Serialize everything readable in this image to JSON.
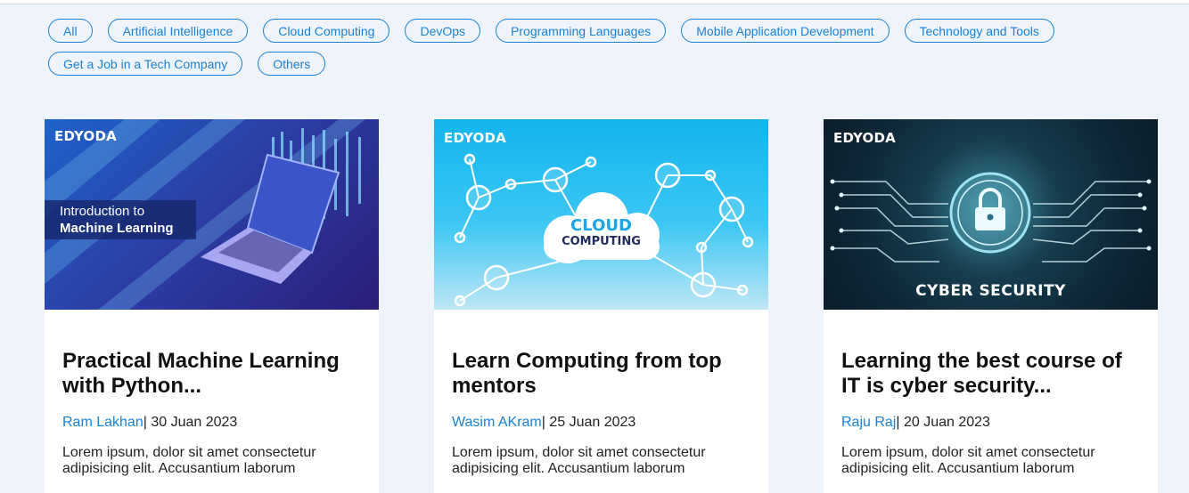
{
  "filters": {
    "row1": [
      "All",
      "Artificial Intelligence",
      "Cloud Computing",
      "DevOps",
      "Programming Languages",
      "Mobile Application Development",
      "Technology and Tools"
    ],
    "row2": [
      "Get a Job in a Tech Company",
      "Others"
    ]
  },
  "colors": {
    "accent": "#1a82d8",
    "page_bg": "#eef3fc"
  },
  "cards": [
    {
      "brand": "EDYODA",
      "image_line1": "Introduction to",
      "image_line2": "Machine Learning",
      "title": "Practical Machine Learning with Python...",
      "author": "Ram Lakhan",
      "date": "| 30 Juan 2023",
      "excerpt": "Lorem ipsum, dolor sit amet consectetur adipisicing elit. Accusantium laborum"
    },
    {
      "brand": "EDYODA",
      "image_line1": "CLOUD",
      "image_line2": "COMPUTING",
      "title": "Learn Computing from top mentors",
      "author": "Wasim AKram",
      "date": "| 25 Juan 2023",
      "excerpt": "Lorem ipsum, dolor sit amet consectetur adipisicing elit. Accusantium laborum"
    },
    {
      "brand": "EDYODA",
      "image_line1": "CYBER SECURITY",
      "title": "Learning the best course of IT is cyber security...",
      "author": "Raju Raj",
      "date": "| 20 Juan 2023",
      "excerpt": "Lorem ipsum, dolor sit amet consectetur adipisicing elit. Accusantium laborum"
    }
  ]
}
